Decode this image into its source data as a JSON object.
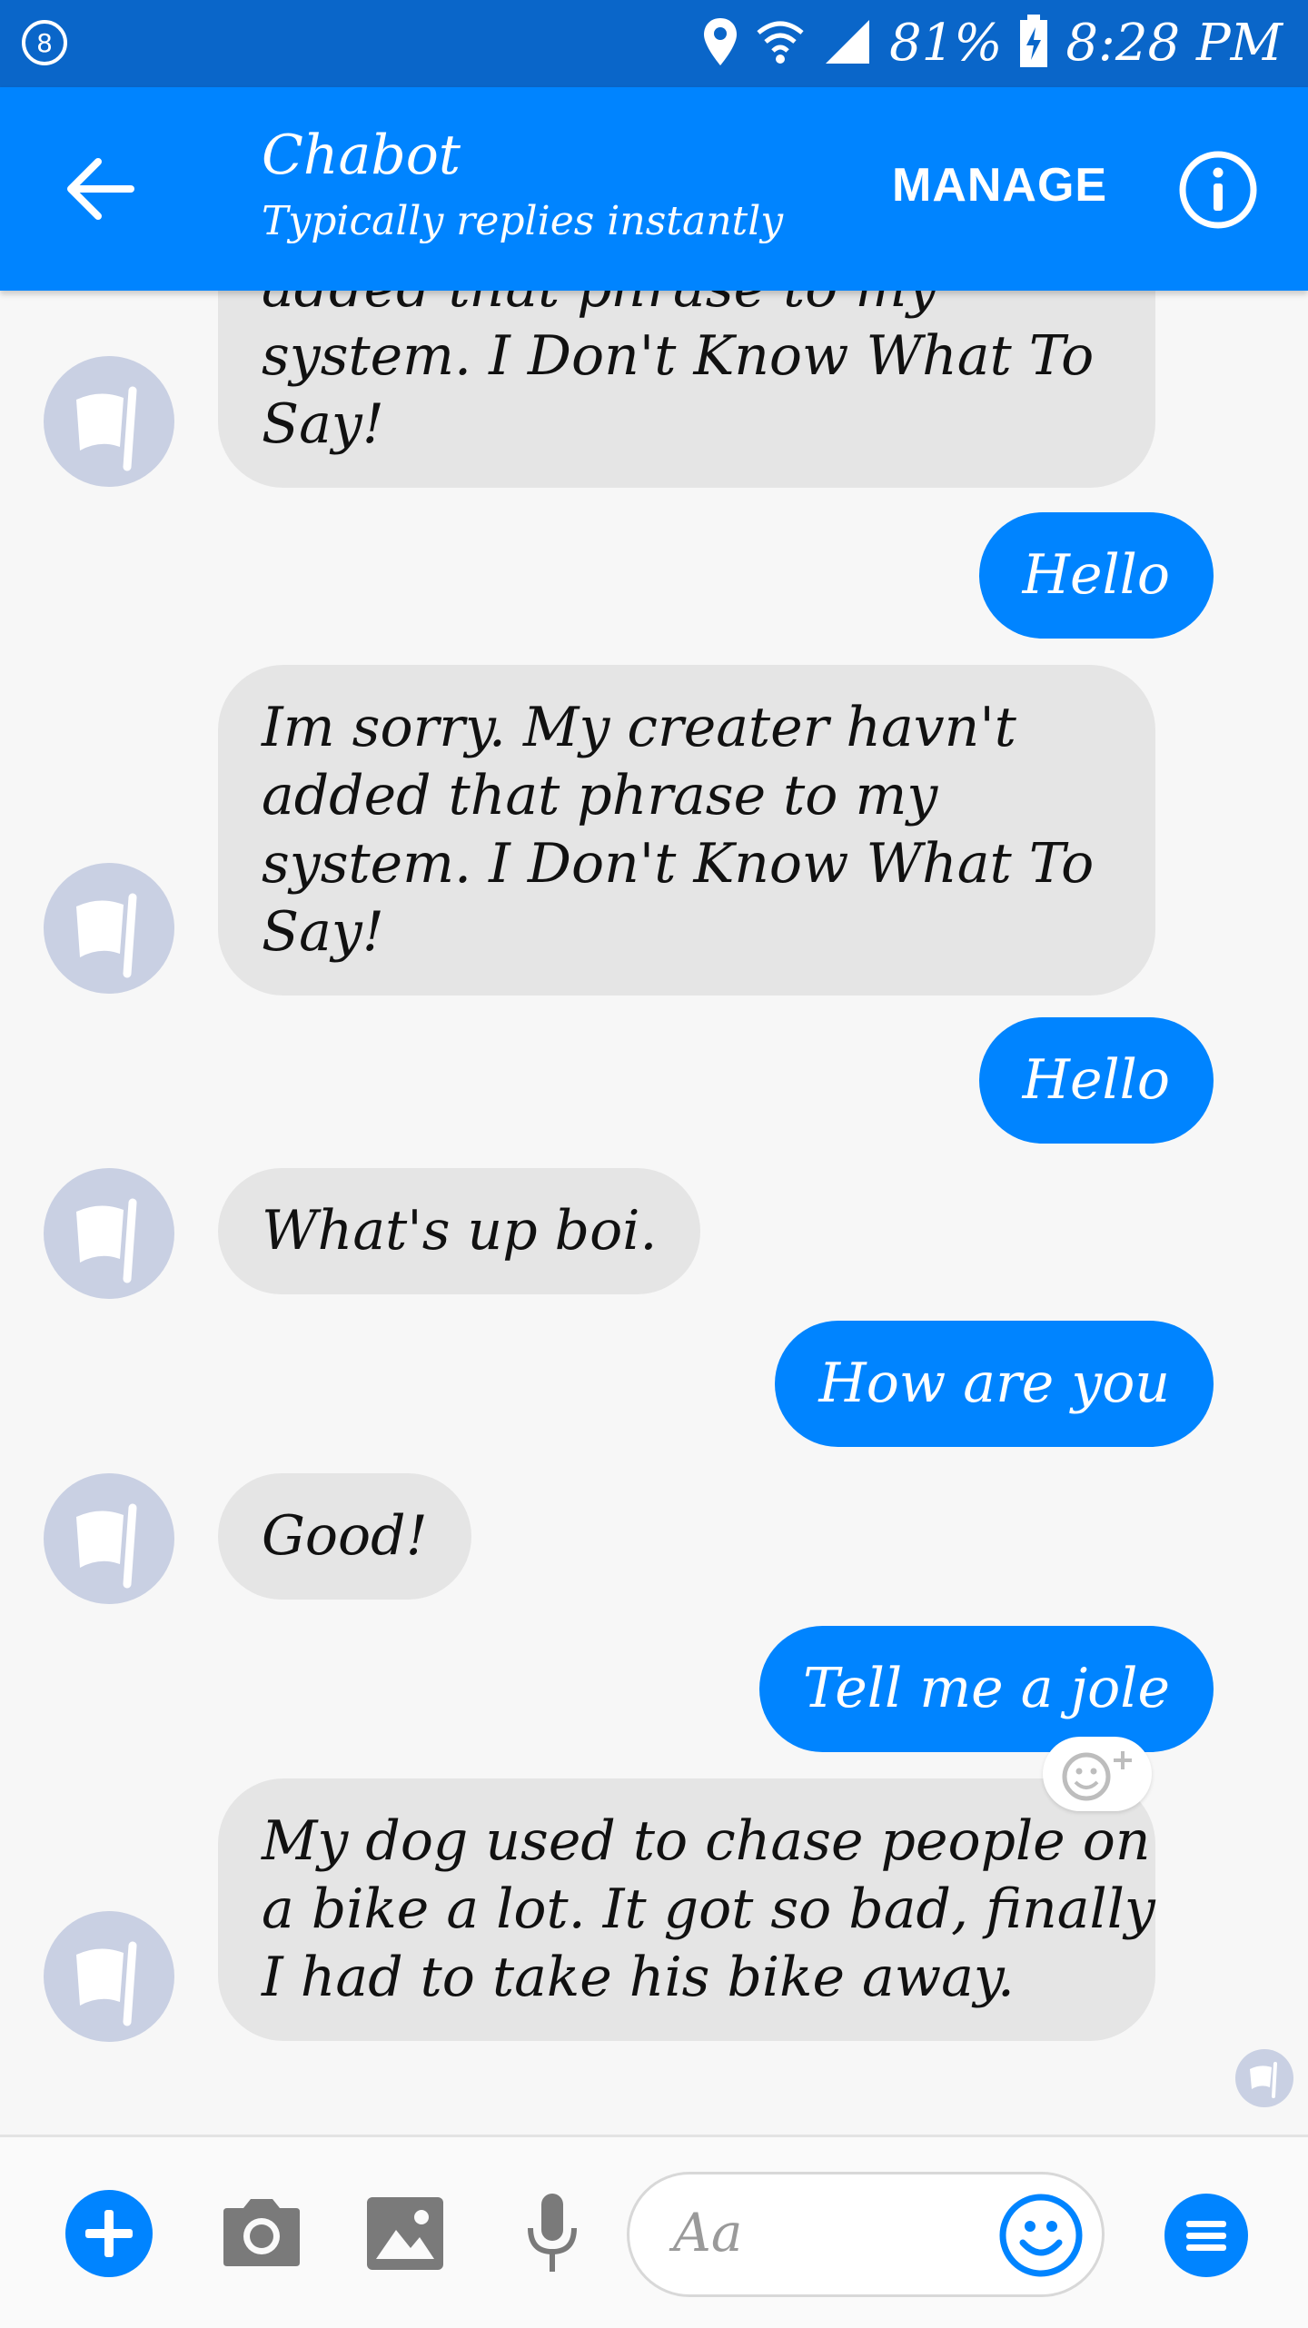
{
  "status_bar": {
    "battery": "81%",
    "time": "8:28 PM",
    "icons": [
      "notification-badge-icon",
      "location-icon",
      "wifi-icon",
      "signal-icon",
      "battery-charging-icon"
    ]
  },
  "header": {
    "title": "Chabot",
    "subtitle": "Typically replies instantly",
    "manage_label": "MANAGE",
    "icons": [
      "back-arrow-icon",
      "info-icon"
    ]
  },
  "messages": [
    {
      "sender": "bot",
      "lines": [
        "added that phrase to my",
        "system. I Don't Know What To",
        "Say!"
      ]
    },
    {
      "sender": "user",
      "lines": [
        "Hello"
      ]
    },
    {
      "sender": "bot",
      "lines": [
        "Im sorry. My creater havn't",
        "added that phrase to my",
        "system. I Don't Know What To",
        "Say!"
      ]
    },
    {
      "sender": "user",
      "lines": [
        "Hello"
      ]
    },
    {
      "sender": "bot",
      "lines": [
        "What's up boi."
      ]
    },
    {
      "sender": "user",
      "lines": [
        "How are you"
      ]
    },
    {
      "sender": "bot",
      "lines": [
        "Good!"
      ]
    },
    {
      "sender": "user",
      "lines": [
        "Tell me a jole"
      ]
    },
    {
      "sender": "bot",
      "lines": [
        "My dog used to chase people on",
        "a bike a lot. It got so bad, finally",
        "I had to take his bike away."
      ]
    }
  ],
  "composer": {
    "placeholder": "Aa",
    "icons": [
      "plus-icon",
      "camera-icon",
      "image-icon",
      "microphone-icon",
      "emoji-icon",
      "menu-icon"
    ]
  },
  "colors": {
    "status_bar": "#0a66c9",
    "header": "#0084ff",
    "user_bubble": "#0084ff",
    "bot_bubble": "#e5e5e5",
    "avatar": "#c9d0e3"
  }
}
